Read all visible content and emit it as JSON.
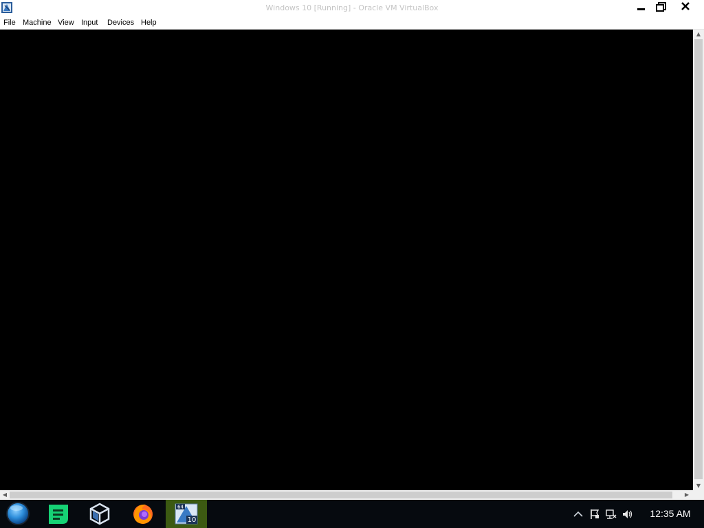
{
  "window": {
    "title": "Windows 10 [Running] - Oracle VM VirtualBox"
  },
  "menubar": {
    "items": [
      "File",
      "Machine",
      "View",
      "Input",
      "Devices",
      "Help"
    ]
  },
  "taskbar": {
    "apps": [
      {
        "name": "start-orb",
        "icon": "globe-orb-icon"
      },
      {
        "name": "notes",
        "icon": "note-lines-icon"
      },
      {
        "name": "virtualbox",
        "icon": "virtualbox-cube-icon"
      },
      {
        "name": "firefox",
        "icon": "firefox-icon"
      },
      {
        "name": "windows-10-vm",
        "icon": "vm-window-icon",
        "badge_top": "64",
        "badge_bottom": "10",
        "active": true
      }
    ],
    "tray": [
      "chevron-up-icon",
      "flag-icon",
      "network-icon",
      "volume-icon"
    ],
    "clock": "12:35 AM"
  },
  "colors": {
    "vm_background": "#000000",
    "taskbar": "#060a0f",
    "active_task": "#3c5a12",
    "notes_green": "#16d275",
    "start_orb": "#2f8fdc"
  }
}
